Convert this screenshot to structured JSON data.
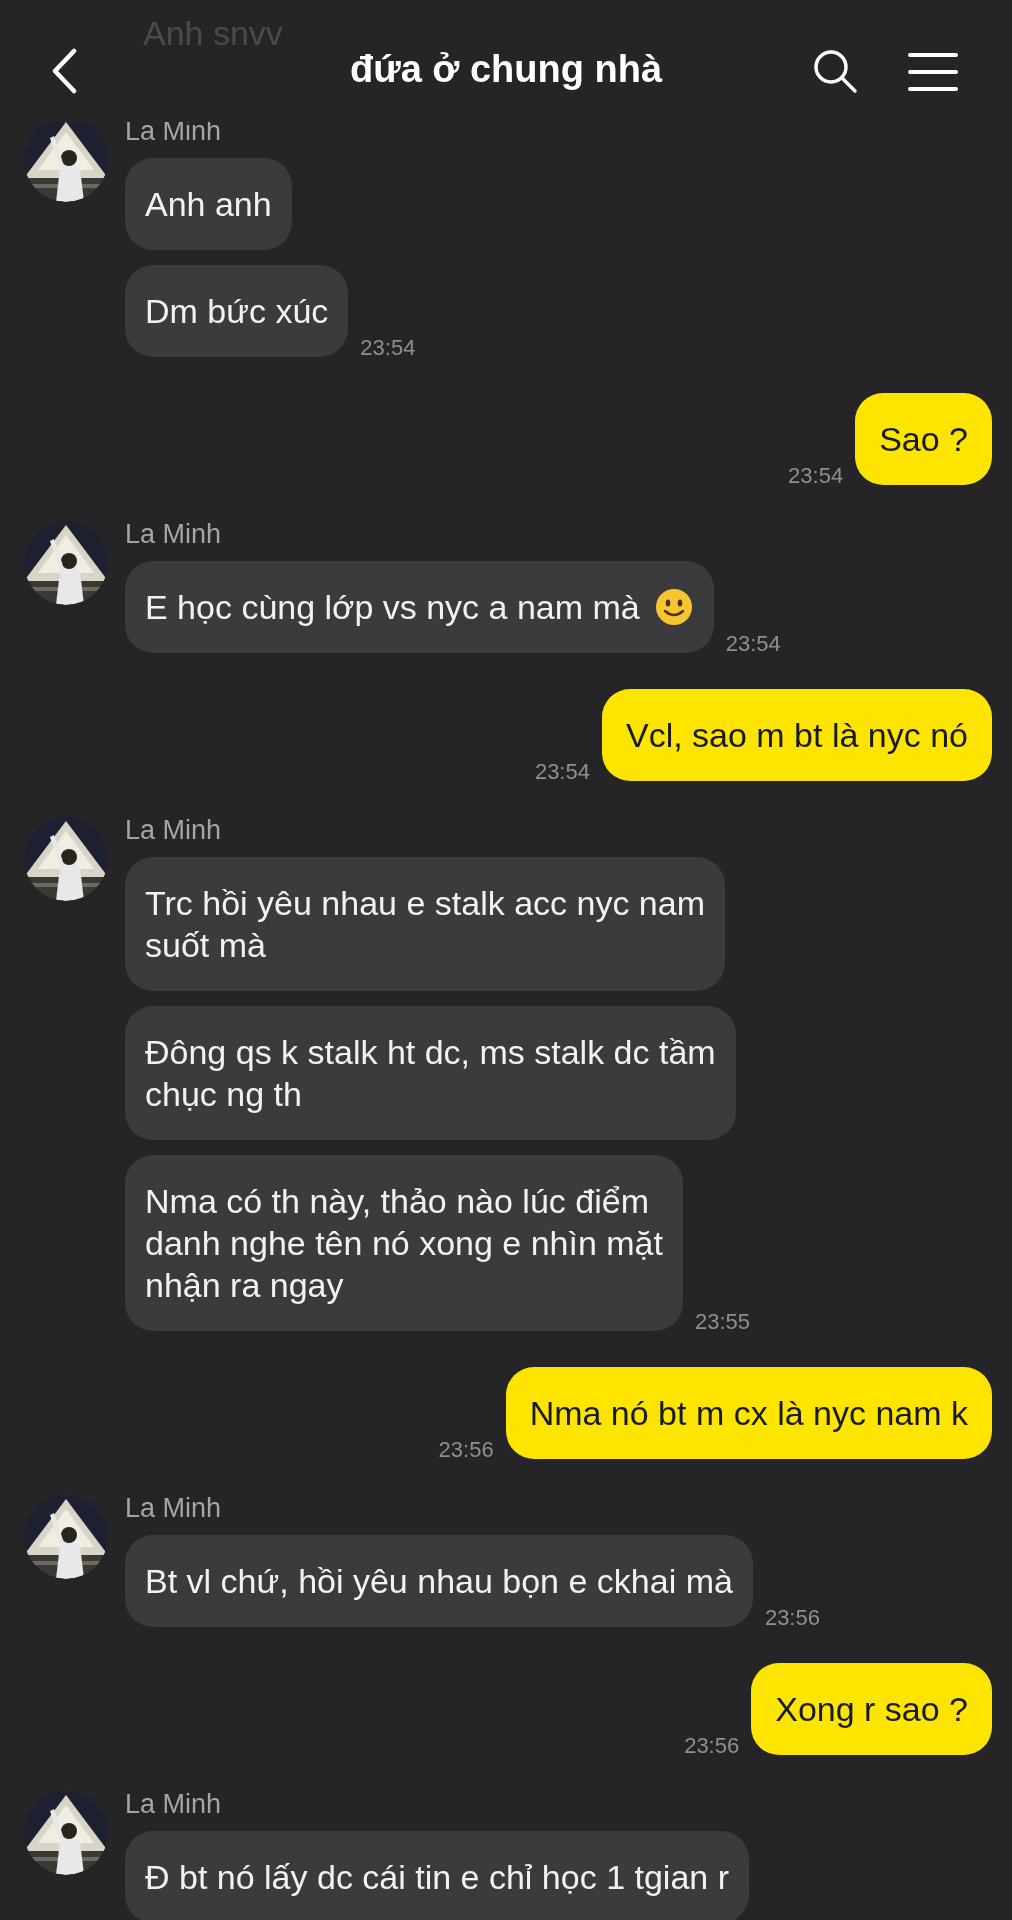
{
  "header": {
    "title": "đứa ở chung nhà",
    "peek_message": "Anh snvv"
  },
  "messages": [
    {
      "kind": "received",
      "sender": "La Minh",
      "bubbles": [
        {
          "kind": "text",
          "text": "Anh anh"
        },
        {
          "kind": "text",
          "text": "Dm bức xúc"
        }
      ],
      "time": "23:54"
    },
    {
      "kind": "sent",
      "bubbles": [
        {
          "kind": "text",
          "text": "Sao ?"
        }
      ],
      "time": "23:54"
    },
    {
      "kind": "received",
      "sender": "La Minh",
      "bubbles": [
        {
          "kind": "text_smiley",
          "text": "E học cùng lớp vs nyc a nam mà"
        }
      ],
      "time": "23:54"
    },
    {
      "kind": "sent",
      "bubbles": [
        {
          "kind": "text",
          "text": "Vcl, sao m bt là nyc nó"
        }
      ],
      "time": "23:54"
    },
    {
      "kind": "received",
      "sender": "La Minh",
      "bubbles": [
        {
          "kind": "text",
          "text": "Trc hồi yêu nhau e stalk acc nyc nam\nsuốt mà"
        },
        {
          "kind": "text",
          "text": "Đông qs k stalk ht dc, ms stalk dc tầm\nchục ng th"
        },
        {
          "kind": "text",
          "text": "Nma có th này, thảo nào lúc điểm\ndanh nghe tên nó xong e nhìn mặt\nnhận ra ngay"
        }
      ],
      "time": "23:55"
    },
    {
      "kind": "sent",
      "bubbles": [
        {
          "kind": "text",
          "text": "Nma nó bt m cx là nyc nam k"
        }
      ],
      "time": "23:56"
    },
    {
      "kind": "received",
      "sender": "La Minh",
      "bubbles": [
        {
          "kind": "text",
          "text": "Bt vl chứ, hồi yêu nhau bọn e ckhai mà"
        }
      ],
      "time": "23:56"
    },
    {
      "kind": "sent",
      "bubbles": [
        {
          "kind": "text",
          "text": "Xong r sao ?"
        }
      ],
      "time": "23:56"
    },
    {
      "kind": "received",
      "sender": "La Minh",
      "bubbles": [
        {
          "kind": "text",
          "text": "Đ bt nó lấy dc cái tin e chỉ học 1 tgian r"
        }
      ]
    }
  ]
}
